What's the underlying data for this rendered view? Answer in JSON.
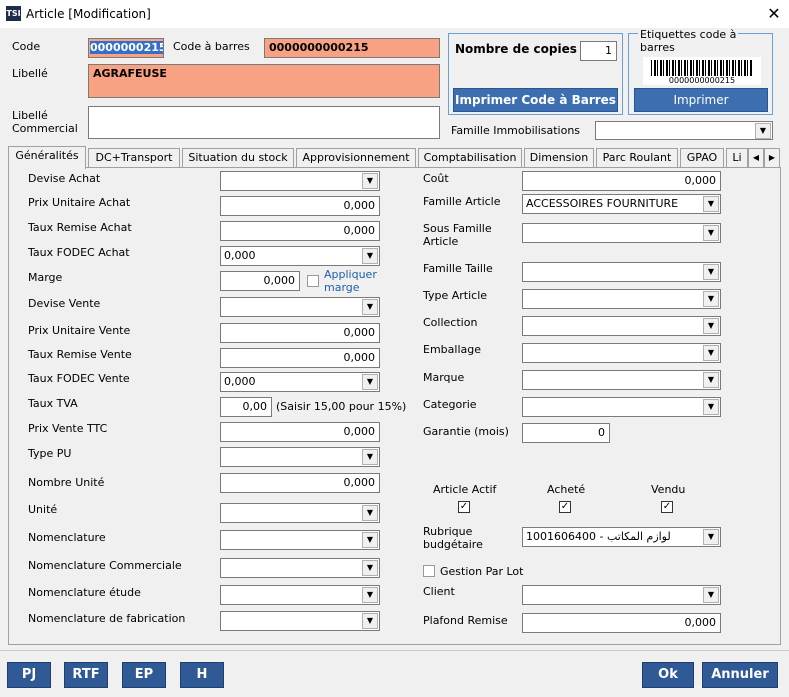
{
  "window": {
    "app_icon": "TSI",
    "title": "Article [Modification]",
    "close": "✕"
  },
  "header": {
    "code_label": "Code",
    "code_value": "0000000215",
    "barcode_label": "Code à barres",
    "barcode_value": "0000000000215",
    "libelle_label": "Libellé",
    "libelle_value": "AGRAFEUSE",
    "libelle_commercial_label": "Libellé\nCommercial",
    "libelle_commercial_value": "",
    "copies_label": "Nombre de copies",
    "copies_value": "1",
    "print_barcode_button": "Imprimer Code à Barres",
    "etiquettes_title": "Etiquettes code à\nbarres",
    "barcode_image_text": "0000000000215",
    "print_button": "Imprimer",
    "famille_immo_label": "Famille Immobilisations",
    "famille_immo_value": ""
  },
  "tabs": [
    "Généralités",
    "DC+Transport",
    "Situation du stock",
    "Approvisionnement",
    "Comptabilisation",
    "Dimension",
    "Parc Roulant",
    "GPAO",
    "Li"
  ],
  "tab_arrows": {
    "left": "◀",
    "right": "▶"
  },
  "left_fields": {
    "devise_achat": {
      "label": "Devise Achat",
      "value": ""
    },
    "prix_unitaire_achat": {
      "label": "Prix Unitaire Achat",
      "value": "0,000"
    },
    "taux_remise_achat": {
      "label": "Taux Remise Achat",
      "value": "0,000"
    },
    "taux_fodec_achat": {
      "label": "Taux FODEC Achat",
      "value": "0,000"
    },
    "marge": {
      "label": "Marge",
      "value": "0,000"
    },
    "appliquer_marge": "Appliquer\nmarge",
    "devise_vente": {
      "label": "Devise Vente",
      "value": ""
    },
    "prix_unitaire_vente": {
      "label": "Prix Unitaire Vente",
      "value": "0,000"
    },
    "taux_remise_vente": {
      "label": "Taux Remise Vente",
      "value": "0,000"
    },
    "taux_fodec_vente": {
      "label": "Taux FODEC Vente",
      "value": "0,000"
    },
    "taux_tva": {
      "label": "Taux TVA",
      "value": "0,00",
      "hint": "(Saisir 15,00 pour 15%)"
    },
    "prix_vente_ttc": {
      "label": "Prix Vente TTC",
      "value": "0,000"
    },
    "type_pu": {
      "label": "Type PU",
      "value": ""
    },
    "nombre_unite": {
      "label": "Nombre Unité",
      "value": "0,000"
    },
    "unite": {
      "label": "Unité",
      "value": ""
    },
    "nomenclature": {
      "label": "Nomenclature",
      "value": ""
    },
    "nomenclature_commerciale": {
      "label": "Nomenclature Commerciale",
      "value": ""
    },
    "nomenclature_etude": {
      "label": "Nomenclature étude",
      "value": ""
    },
    "nomenclature_fabrication": {
      "label": "Nomenclature de fabrication",
      "value": ""
    }
  },
  "right_fields": {
    "cout": {
      "label": "Coût",
      "value": "0,000"
    },
    "famille_article": {
      "label": "Famille Article",
      "value": "ACCESSOIRES FOURNITURE"
    },
    "sous_famille_article": {
      "label": "Sous Famille\nArticle",
      "value": ""
    },
    "famille_taille": {
      "label": "Famille Taille",
      "value": ""
    },
    "type_article": {
      "label": "Type Article",
      "value": ""
    },
    "collection": {
      "label": "Collection",
      "value": ""
    },
    "emballage": {
      "label": "Emballage",
      "value": ""
    },
    "marque": {
      "label": "Marque",
      "value": ""
    },
    "categorie": {
      "label": "Categorie",
      "value": ""
    },
    "garantie": {
      "label": "Garantie (mois)",
      "value": "0"
    },
    "article_actif": "Article Actif",
    "achete": "Acheté",
    "vendu": "Vendu",
    "rubrique": {
      "label": "Rubrique\nbudgétaire",
      "value": "1001606400 - لوازم المكاتب"
    },
    "gestion_par_lot": "Gestion Par Lot",
    "client": {
      "label": "Client",
      "value": ""
    },
    "plafond_remise": {
      "label": "Plafond Remise",
      "value": "0,000"
    }
  },
  "checkmark": "✓",
  "dropdown_arrow": "▼",
  "footer": {
    "pj": "PJ",
    "rtf": "RTF",
    "ep": "EP",
    "h": "H",
    "ok": "Ok",
    "annuler": "Annuler"
  },
  "colors": {
    "salmon": "#f9a283",
    "button_blue": "#3d6fb0",
    "group_border": "#6aa0d8"
  }
}
